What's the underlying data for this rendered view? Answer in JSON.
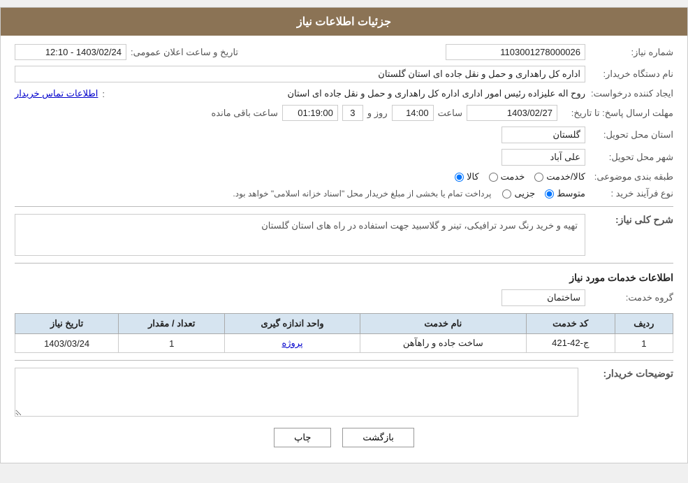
{
  "header": {
    "title": "جزئیات اطلاعات نیاز"
  },
  "form": {
    "shomara_niaz_label": "شماره نیاز:",
    "shomara_niaz_value": "1103001278000026",
    "name_dastgah_label": "نام دستگاه خریدار:",
    "name_dastgah_value": "اداره کل راهداری و حمل و نقل جاده ای استان گلستان",
    "tarikh_label": "تاریخ و ساعت اعلان عمومی:",
    "tarikh_value": "1403/02/24 - 12:10",
    "ijad_label": "ایجاد کننده درخواست:",
    "ijad_value": "روح اله علیزاده رئیس امور اداری اداره کل راهداری و حمل و نقل جاده ای استان",
    "ijad_link": "اطلاعات تماس خریدار",
    "mohlet_label": "مهلت ارسال پاسخ: تا تاریخ:",
    "mohlet_date": "1403/02/27",
    "mohlet_saat_label": "ساعت",
    "mohlet_saat_value": "14:00",
    "mohlet_rooz_label": "روز و",
    "mohlet_rooz_value": "3",
    "mohlet_remaining_label": "ساعت باقی مانده",
    "mohlet_remaining_value": "01:19:00",
    "ostan_tahvil_label": "استان محل تحویل:",
    "ostan_tahvil_value": "گلستان",
    "shahr_tahvil_label": "شهر محل تحویل:",
    "shahr_tahvil_value": "علی آباد",
    "tabaqe_label": "طبقه بندی موضوعی:",
    "tabaqe_options": [
      {
        "value": "kala",
        "label": "کالا"
      },
      {
        "value": "khedmat",
        "label": "خدمت"
      },
      {
        "value": "kala_khedmat",
        "label": "کالا/خدمت"
      }
    ],
    "tabaqe_selected": "kala",
    "nooe_farayand_label": "نوع فرآیند خرید :",
    "nooe_farayand_options": [
      {
        "value": "jozii",
        "label": "جزیی"
      },
      {
        "value": "motavaset",
        "label": "متوسط"
      }
    ],
    "nooe_farayand_selected": "motavaset",
    "nooe_farayand_note": "پرداخت تمام یا بخشی از مبلغ خریدار محل \"اسناد خزانه اسلامی\" خواهد بود.",
    "sharh_label": "شرح کلی نیاز:",
    "sharh_value": "تهیه و خرید رنگ سرد ترافیکی، تینر و گلاسبید جهت استفاده در راه های استان گلستان",
    "khadamat_label": "اطلاعات خدمات مورد نیاز",
    "goroh_label": "گروه خدمت:",
    "goroh_value": "ساختمان",
    "table": {
      "headers": [
        "ردیف",
        "کد خدمت",
        "نام خدمت",
        "واحد اندازه گیری",
        "تعداد / مقدار",
        "تاریخ نیاز"
      ],
      "rows": [
        {
          "radif": "1",
          "code": "ج-42-421",
          "name": "ساخت جاده و راهآهن",
          "unit": "پروژه",
          "count": "1",
          "date": "1403/03/24"
        }
      ]
    },
    "tawsihat_label": "توضیحات خریدار:",
    "tawsihat_value": ""
  },
  "buttons": {
    "print_label": "چاپ",
    "back_label": "بازگشت"
  }
}
